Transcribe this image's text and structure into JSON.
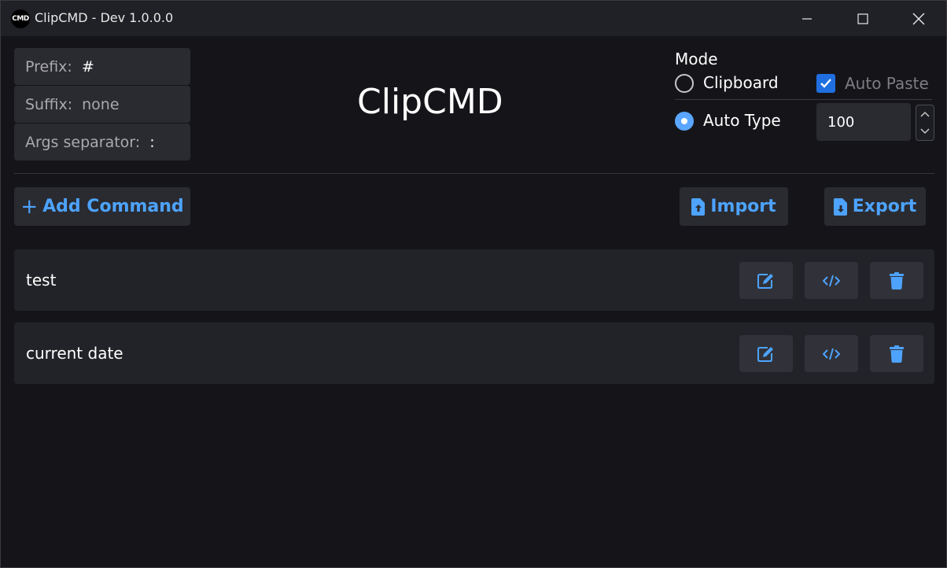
{
  "window": {
    "title": "ClipCMD - Dev 1.0.0.0",
    "logo_text": "CMD",
    "controls": [
      "minimize-icon",
      "maximize-icon",
      "close-icon"
    ]
  },
  "settings": {
    "prefix_label": "Prefix:",
    "prefix_value": "#",
    "suffix_label": "Suffix:",
    "suffix_value": "none",
    "args_label": "Args separator:",
    "args_value": ":"
  },
  "heading": "ClipCMD",
  "mode": {
    "label": "Mode",
    "clipboard_label": "Clipboard",
    "clipboard_selected": false,
    "autotype_label": "Auto Type",
    "autotype_selected": true,
    "auto_paste_label": "Auto Paste",
    "auto_paste_checked": true,
    "delay_value": "100"
  },
  "toolbar": {
    "add_label": "Add Command",
    "import_label": "Import",
    "export_label": "Export"
  },
  "commands": [
    {
      "name": "test"
    },
    {
      "name": "current date"
    }
  ],
  "colors": {
    "accent": "#4da3ff",
    "background": "#151519",
    "panel": "#2a2b31",
    "checkbox": "#1f6fe0"
  }
}
